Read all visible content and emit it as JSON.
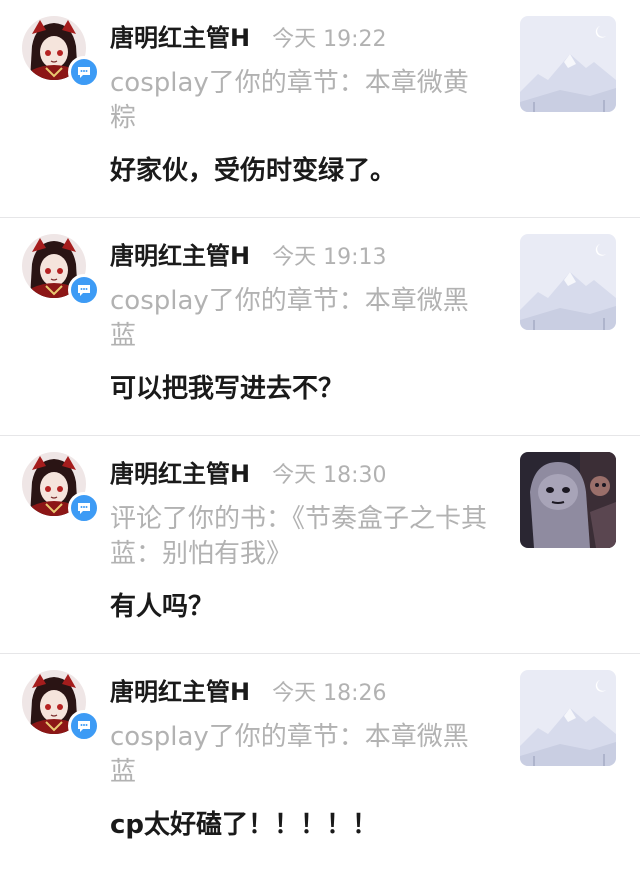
{
  "notifications": [
    {
      "username": "唐明红主管H",
      "time": "今天 19:22",
      "action": "cosplay了你的章节：本章微黄粽",
      "comment": "好家伙，受伤时变绿了。",
      "thumbnail": "placeholder-mountain"
    },
    {
      "username": "唐明红主管H",
      "time": "今天 19:13",
      "action": "cosplay了你的章节：本章微黑蓝",
      "comment": "可以把我写进去不？",
      "thumbnail": "placeholder-mountain"
    },
    {
      "username": "唐明红主管H",
      "time": "今天 18:30",
      "action": "评论了你的书：《节奏盒子之卡其蓝：别怕有我》",
      "comment": "有人吗？",
      "thumbnail": "book-cover-illustration"
    },
    {
      "username": "唐明红主管H",
      "time": "今天 18:26",
      "action": "cosplay了你的章节：本章微黑蓝",
      "comment": "cp太好磕了！！！！！",
      "thumbnail": "placeholder-mountain"
    }
  ],
  "colors": {
    "primary_text": "#1a1a1a",
    "secondary_text": "#b2b2b2",
    "badge_blue": "#3d9bf5",
    "divider": "#e6e6e8",
    "placeholder_bg": "#e9ebf5"
  }
}
